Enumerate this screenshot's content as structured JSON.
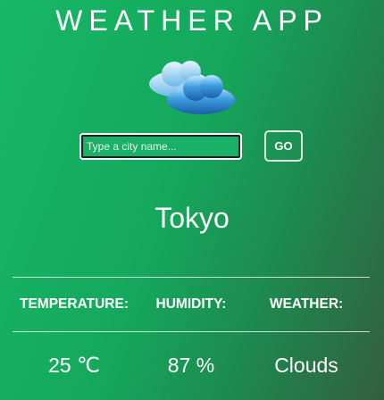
{
  "header": {
    "title": "WEATHER APP"
  },
  "weather_icon": "cloud-icon",
  "search": {
    "placeholder": "Type a city name...",
    "value": "",
    "go_label": "GO"
  },
  "result": {
    "city": "Tokyo",
    "columns": [
      {
        "header": "TEMPERATURE:",
        "value": "25 ℃"
      },
      {
        "header": "HUMIDITY:",
        "value": "87 %"
      },
      {
        "header": "WEATHER:",
        "value": "Clouds"
      }
    ]
  },
  "colors": {
    "background_start": "#16b766",
    "background_end": "#335f3c",
    "text": "#ffffff",
    "cloud": "#2f8fd6"
  }
}
